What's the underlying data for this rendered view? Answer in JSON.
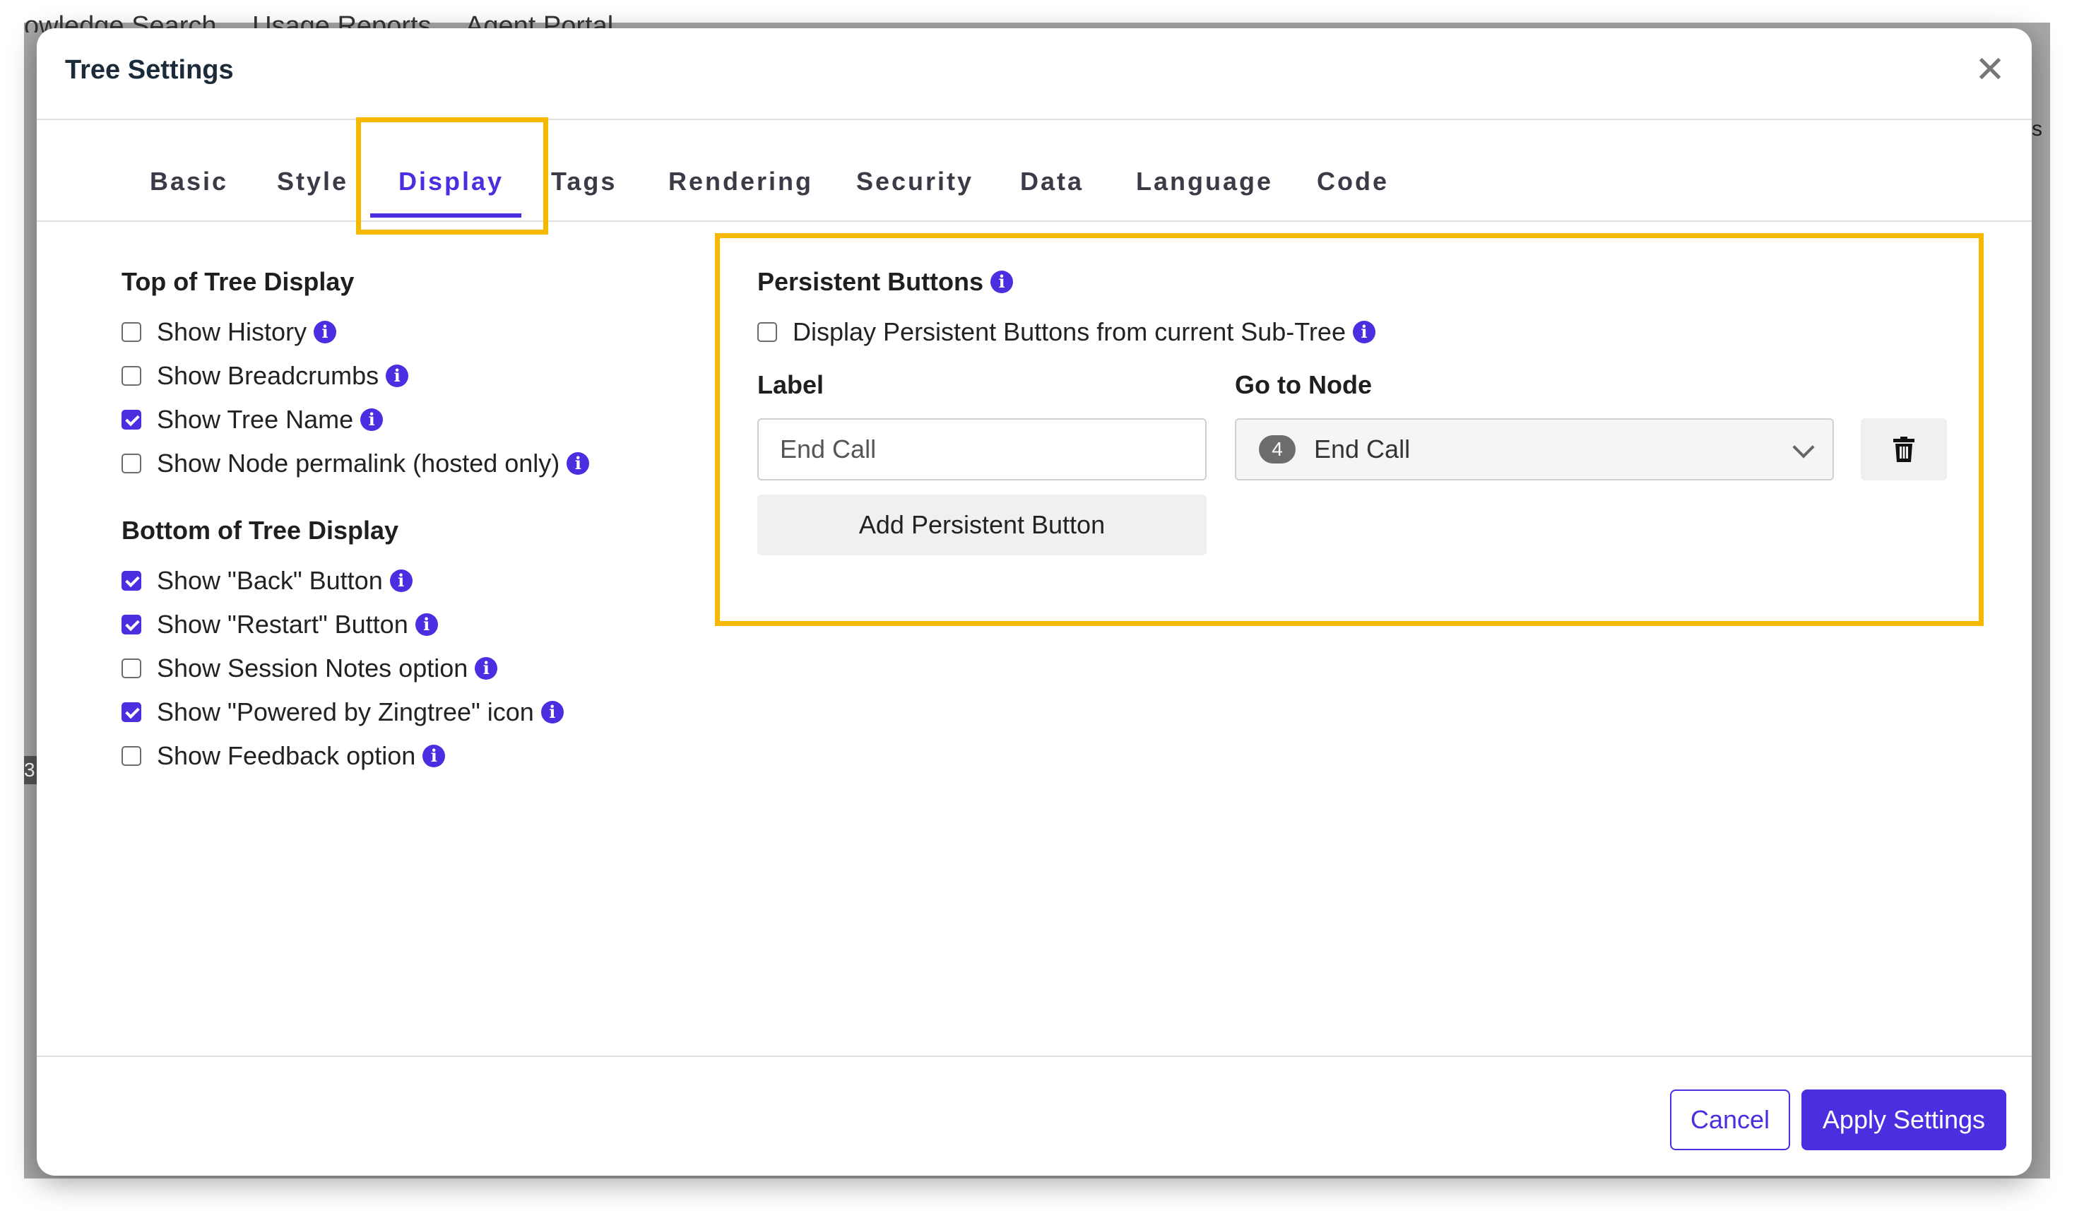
{
  "background": {
    "nav_items": [
      "owledge Search",
      "Usage Reports",
      "Agent Portal"
    ],
    "right_fragment": "s",
    "left_number": "3"
  },
  "modal": {
    "title": "Tree Settings",
    "close_symbol": "✕"
  },
  "tabs": [
    {
      "label": "Basic",
      "active": false
    },
    {
      "label": "Style",
      "active": false
    },
    {
      "label": "Display",
      "active": true
    },
    {
      "label": "Tags",
      "active": false
    },
    {
      "label": "Rendering",
      "active": false
    },
    {
      "label": "Security",
      "active": false
    },
    {
      "label": "Data",
      "active": false
    },
    {
      "label": "Language",
      "active": false
    },
    {
      "label": "Code",
      "active": false
    }
  ],
  "top_display": {
    "title": "Top of Tree Display",
    "options": [
      {
        "label": "Show History",
        "checked": false
      },
      {
        "label": "Show Breadcrumbs",
        "checked": false
      },
      {
        "label": "Show Tree Name",
        "checked": true
      },
      {
        "label": "Show Node permalink (hosted only)",
        "checked": false
      }
    ]
  },
  "bottom_display": {
    "title": "Bottom of Tree Display",
    "options": [
      {
        "label": "Show \"Back\" Button",
        "checked": true
      },
      {
        "label": "Show \"Restart\" Button",
        "checked": true
      },
      {
        "label": "Show Session Notes option",
        "checked": false
      },
      {
        "label": "Show \"Powered by Zingtree\" icon",
        "checked": true
      },
      {
        "label": "Show Feedback option",
        "checked": false
      }
    ]
  },
  "persistent": {
    "title": "Persistent Buttons",
    "subtree_option": {
      "label": "Display Persistent Buttons from current Sub-Tree",
      "checked": false
    },
    "label_header": "Label",
    "node_header": "Go to Node",
    "label_value": "End Call",
    "node_number": "4",
    "node_value": "End Call",
    "add_button": "Add Persistent Button"
  },
  "footer": {
    "cancel": "Cancel",
    "apply": "Apply Settings"
  },
  "colors": {
    "accent": "#4b2ee0",
    "highlight": "#f6b800"
  },
  "icons": {
    "info": "i",
    "close": "close-icon",
    "trash": "trash-icon",
    "chevron": "chevron-down-icon"
  }
}
